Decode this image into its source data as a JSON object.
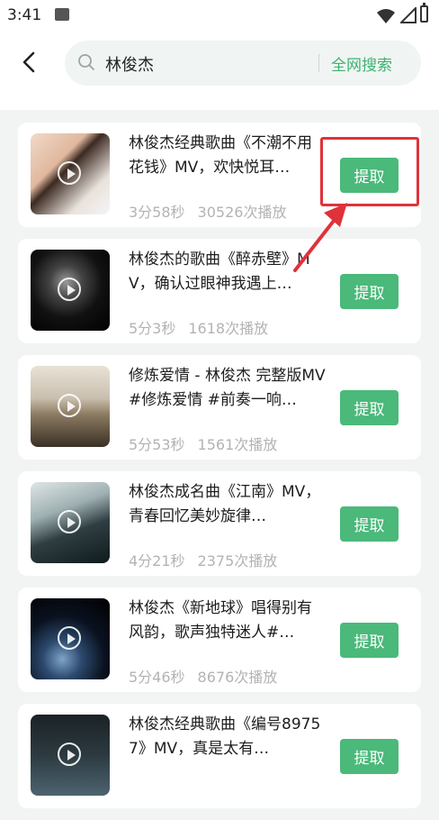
{
  "status_bar": {
    "time": "3:41",
    "icons": [
      "image-icon",
      "wifi-icon",
      "cellular-icon",
      "battery-charging-icon"
    ]
  },
  "header": {
    "back_icon": "chevron-left-icon",
    "search_icon": "search-icon",
    "query": "林俊杰",
    "submit_label": "全网搜索"
  },
  "colors": {
    "accent": "#3fb270",
    "button": "#4ab97a",
    "annotation": "#e0323a"
  },
  "results": [
    {
      "title": "林俊杰经典歌曲《不潮不用花钱》MV，欢快悦耳…",
      "duration": "3分58秒",
      "plays": "30526次播放",
      "action": "提取"
    },
    {
      "title": "林俊杰的歌曲《醉赤壁》MV，确认过眼神我遇上…",
      "duration": "5分3秒",
      "plays": "1618次播放",
      "action": "提取"
    },
    {
      "title": "修炼爱情 - 林俊杰 完整版MV#修炼爱情 #前奏一响…",
      "duration": "5分53秒",
      "plays": "1561次播放",
      "action": "提取"
    },
    {
      "title": "林俊杰成名曲《江南》MV，青春回忆美妙旋律…",
      "duration": "4分21秒",
      "plays": "2375次播放",
      "action": "提取"
    },
    {
      "title": "林俊杰《新地球》唱得别有风韵，歌声独特迷人#…",
      "duration": "5分46秒",
      "plays": "8676次播放",
      "action": "提取"
    },
    {
      "title": "林俊杰经典歌曲《编号89757》MV，真是太有…",
      "duration": "",
      "plays": "",
      "action": "提取"
    }
  ]
}
